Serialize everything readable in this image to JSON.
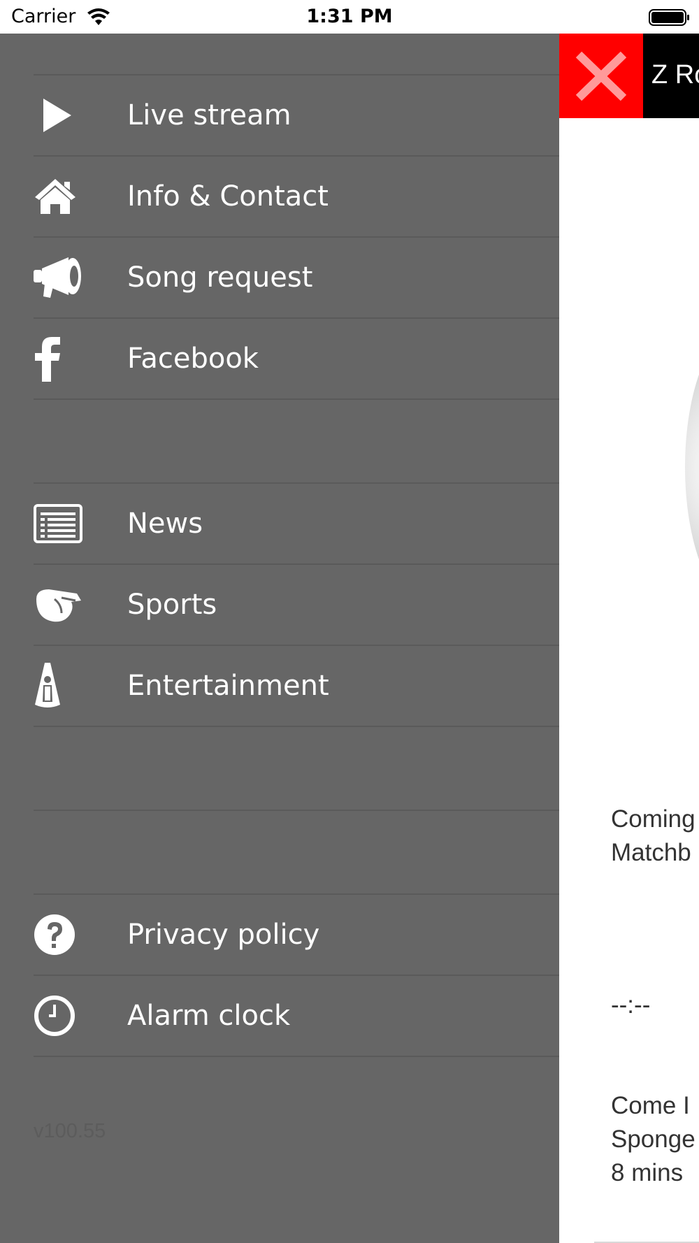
{
  "status_bar": {
    "carrier": "Carrier",
    "time": "1:31 PM"
  },
  "drawer": {
    "items": [
      {
        "label": "Live stream",
        "icon": "play-icon"
      },
      {
        "label": "Info & Contact",
        "icon": "home-icon"
      },
      {
        "label": "Song request",
        "icon": "megaphone-icon"
      },
      {
        "label": "Facebook",
        "icon": "facebook-icon"
      },
      {
        "label": "News",
        "icon": "news-icon"
      },
      {
        "label": "Sports",
        "icon": "whistle-icon"
      },
      {
        "label": "Entertainment",
        "icon": "spotlight-icon"
      },
      {
        "label": "Privacy policy",
        "icon": "question-icon"
      },
      {
        "label": "Alarm clock",
        "icon": "clock-icon"
      }
    ],
    "version": "v100.55"
  },
  "main": {
    "title": "Z Ro",
    "coming_up_line1": "Coming",
    "coming_up_line2": "Matchb",
    "time_placeholder": "--:--",
    "previous_line1": "Come I",
    "previous_line2": "Sponge",
    "previous_line3": "8 mins"
  },
  "colors": {
    "drawer_bg": "#666666",
    "close_button": "#ff0000",
    "title_bar": "#000000"
  }
}
